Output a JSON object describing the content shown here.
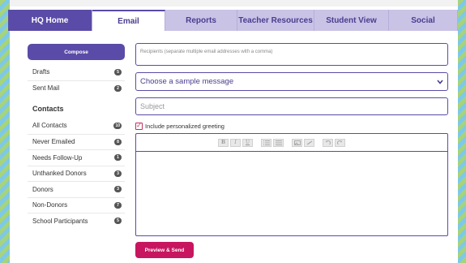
{
  "tabs": [
    {
      "label": "HQ Home"
    },
    {
      "label": "Email"
    },
    {
      "label": "Reports"
    },
    {
      "label": "Teacher Resources"
    },
    {
      "label": "Student View"
    },
    {
      "label": "Social"
    }
  ],
  "sidebar": {
    "compose_label": "Compose",
    "mail_items": [
      {
        "label": "Drafts",
        "count": "5"
      },
      {
        "label": "Sent Mail",
        "count": "2"
      }
    ],
    "contacts_title": "Contacts",
    "contact_items": [
      {
        "label": "All Contacts",
        "count": "10"
      },
      {
        "label": "Never Emailed",
        "count": "8"
      },
      {
        "label": "Needs Follow-Up",
        "count": "1"
      },
      {
        "label": "Unthanked Donors",
        "count": "3"
      },
      {
        "label": "Donors",
        "count": "3"
      },
      {
        "label": "Non-Donors",
        "count": "7"
      },
      {
        "label": "School Participants",
        "count": "5"
      }
    ]
  },
  "email_form": {
    "recipients_placeholder": "Recipients (separate multiple email addresses with a comma)",
    "sample_message_label": "Choose a sample message",
    "subject_placeholder": "Subject",
    "greeting_label": "Include personalized greeting",
    "greeting_checked": true,
    "toolbar": [
      "B",
      "I",
      "U"
    ],
    "preview_send_label": "Preview & Send"
  },
  "colors": {
    "accent": "#5a4ba8",
    "tab_bg": "#c9c3e6",
    "send": "#c8155f"
  }
}
